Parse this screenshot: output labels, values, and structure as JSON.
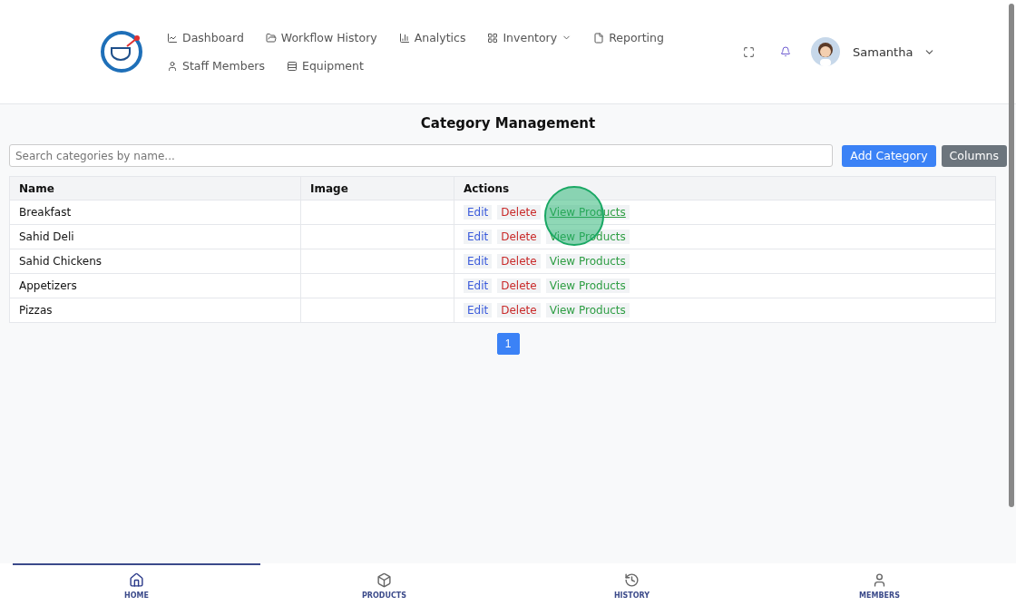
{
  "header": {
    "nav": [
      {
        "label": "Dashboard"
      },
      {
        "label": "Workflow History"
      },
      {
        "label": "Analytics"
      },
      {
        "label": "Inventory",
        "dropdown": true
      },
      {
        "label": "Reporting"
      },
      {
        "label": "Staff Members"
      },
      {
        "label": "Equipment"
      }
    ],
    "user": {
      "name": "Samantha"
    }
  },
  "page": {
    "title": "Category Management",
    "search": {
      "placeholder": "Search categories by name..."
    },
    "buttons": [
      {
        "label": "Add Category",
        "kind": "primary"
      },
      {
        "label": "Columns",
        "kind": "secondary"
      }
    ]
  },
  "table": {
    "columns": [
      "Name",
      "Image",
      "Actions"
    ],
    "rows": [
      {
        "name": "Breakfast",
        "actions": [
          {
            "label": "Edit",
            "kind": "edit",
            "hovered": false
          },
          {
            "label": "Delete",
            "kind": "delete",
            "hovered": false
          },
          {
            "label": "View Products",
            "kind": "view",
            "hovered": true
          }
        ]
      },
      {
        "name": "Sahid Deli",
        "actions": [
          {
            "label": "Edit",
            "kind": "edit",
            "hovered": false
          },
          {
            "label": "Delete",
            "kind": "delete",
            "hovered": false
          },
          {
            "label": "View Products",
            "kind": "view",
            "hovered": false
          }
        ]
      },
      {
        "name": "Sahid Chickens",
        "actions": [
          {
            "label": "Edit",
            "kind": "edit",
            "hovered": false
          },
          {
            "label": "Delete",
            "kind": "delete",
            "hovered": false
          },
          {
            "label": "View Products",
            "kind": "view",
            "hovered": false
          }
        ]
      },
      {
        "name": "Appetizers",
        "actions": [
          {
            "label": "Edit",
            "kind": "edit",
            "hovered": false
          },
          {
            "label": "Delete",
            "kind": "delete",
            "hovered": false
          },
          {
            "label": "View Products",
            "kind": "view",
            "hovered": false
          }
        ]
      },
      {
        "name": "Pizzas",
        "actions": [
          {
            "label": "Edit",
            "kind": "edit",
            "hovered": false
          },
          {
            "label": "Delete",
            "kind": "delete",
            "hovered": false
          },
          {
            "label": "View Products",
            "kind": "view",
            "hovered": false
          }
        ]
      }
    ]
  },
  "pagination": [
    {
      "label": "1",
      "selected": true
    }
  ],
  "bottom_nav": [
    {
      "label": "HOME",
      "selected": true
    },
    {
      "label": "PRODUCTS",
      "selected": false
    },
    {
      "label": "HISTORY",
      "selected": false
    },
    {
      "label": "MEMBERS",
      "selected": false
    }
  ]
}
